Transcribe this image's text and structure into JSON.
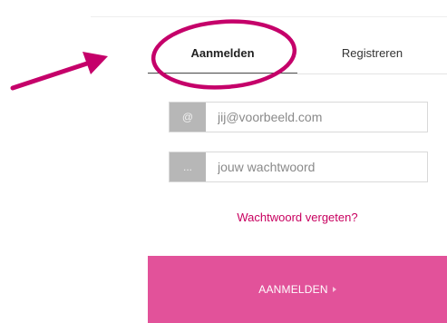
{
  "tabs": {
    "login_label": "Aanmelden",
    "register_label": "Registreren"
  },
  "email": {
    "addon": "@",
    "placeholder": "jij@voorbeeld.com",
    "value": ""
  },
  "password": {
    "addon": "...",
    "placeholder": "jouw wachtwoord",
    "value": ""
  },
  "forgot_link": "Wachtwoord vergeten?",
  "submit_label": "AANMELDEN",
  "colors": {
    "accent": "#c8005f",
    "button": "#e2529a",
    "annotation": "#c5006a"
  },
  "icons": {
    "submit_caret": "caret-right-icon",
    "annotation_arrow": "arrow-icon",
    "annotation_circle": "circle-highlight"
  }
}
